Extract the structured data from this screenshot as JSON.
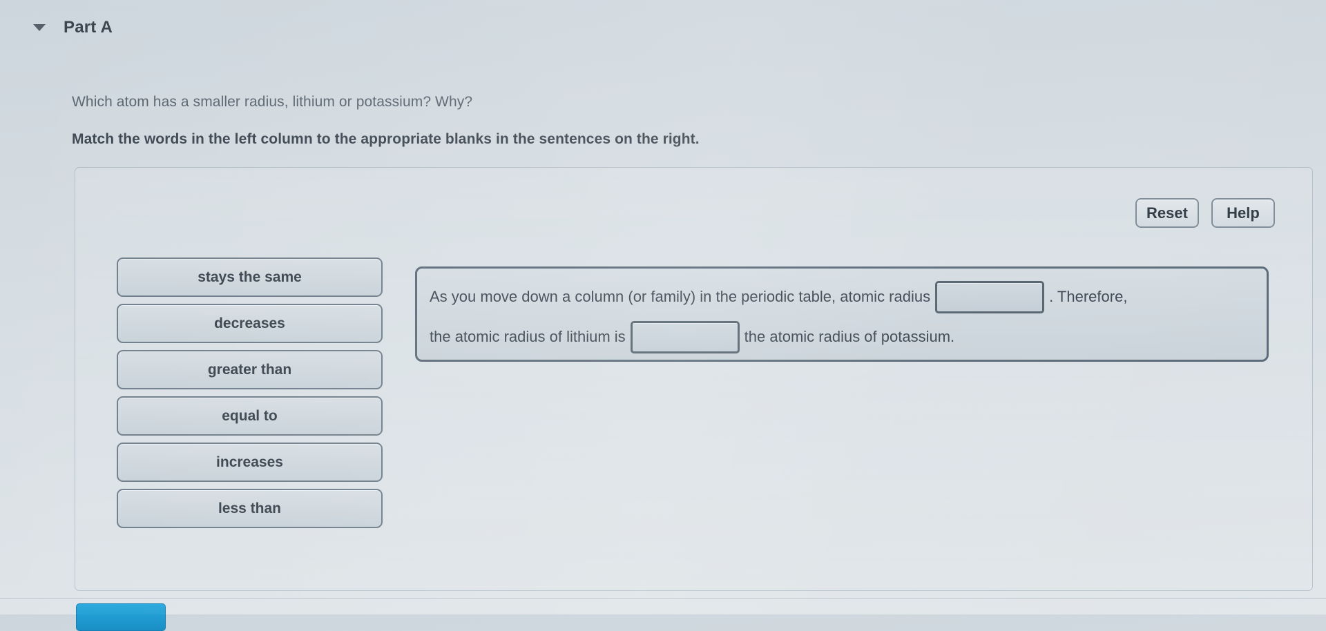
{
  "header": {
    "disclosure_icon": "triangle-down-icon",
    "title": "Part A"
  },
  "prompt": {
    "question": "Which atom has a smaller radius, lithium or potassium? Why?",
    "instruction": "Match the words in the left column to the appropriate blanks in the sentences on the right."
  },
  "toolbar": {
    "reset_label": "Reset",
    "help_label": "Help"
  },
  "word_bank": {
    "items": [
      {
        "label": "stays the same"
      },
      {
        "label": "decreases"
      },
      {
        "label": "greater than"
      },
      {
        "label": "equal to"
      },
      {
        "label": "increases"
      },
      {
        "label": "less than"
      }
    ]
  },
  "sentence": {
    "line1": {
      "before_blank": "As you move down a column (or family) in the periodic table, atomic radius",
      "blank_value": "",
      "after_blank": ". Therefore,"
    },
    "line2": {
      "before_blank": "the atomic radius of lithium is",
      "blank_value": "",
      "after_blank": "the atomic radius of potassium."
    }
  },
  "footer": {
    "submit_label": ""
  },
  "colors": {
    "page_background": "#d6dee4",
    "text_primary": "#3d4752",
    "text_secondary": "#5a6570",
    "tile_border": "#6f7e8b",
    "blank_border": "#56646f",
    "submit_accent": "#1f99d4"
  }
}
